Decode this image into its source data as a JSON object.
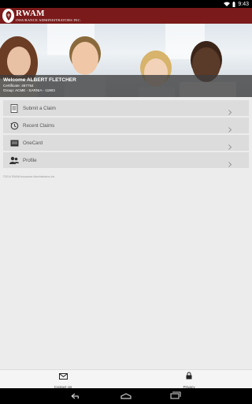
{
  "status_bar": {
    "time": "9:43"
  },
  "header": {
    "logo_text": "RWAM",
    "logo_subtext": "INSURANCE ADMINISTRATORS INC."
  },
  "hero": {
    "welcome": "Welcome ALBERT FLETCHER",
    "certificate": "Certificate: 467764",
    "group": "Group: ACME - SARNIA - 11903"
  },
  "menu": {
    "items": [
      {
        "label": "Submit a Claim",
        "icon": "document-icon"
      },
      {
        "label": "Recent Claims",
        "icon": "history-icon"
      },
      {
        "label": "OneCard",
        "icon": "card-icon"
      },
      {
        "label": "Profile",
        "icon": "profile-icon"
      }
    ]
  },
  "footer": {
    "copyright": "©2014 RWAM Insurance Administrators Inc."
  },
  "tabs": [
    {
      "label": "Contact Us",
      "icon": "envelope-icon"
    },
    {
      "label": "Privacy",
      "icon": "lock-icon"
    }
  ],
  "colors": {
    "header": "#7a1a1a",
    "menu_item": "#dcdcdc",
    "overlay": "#3c3c3c"
  }
}
